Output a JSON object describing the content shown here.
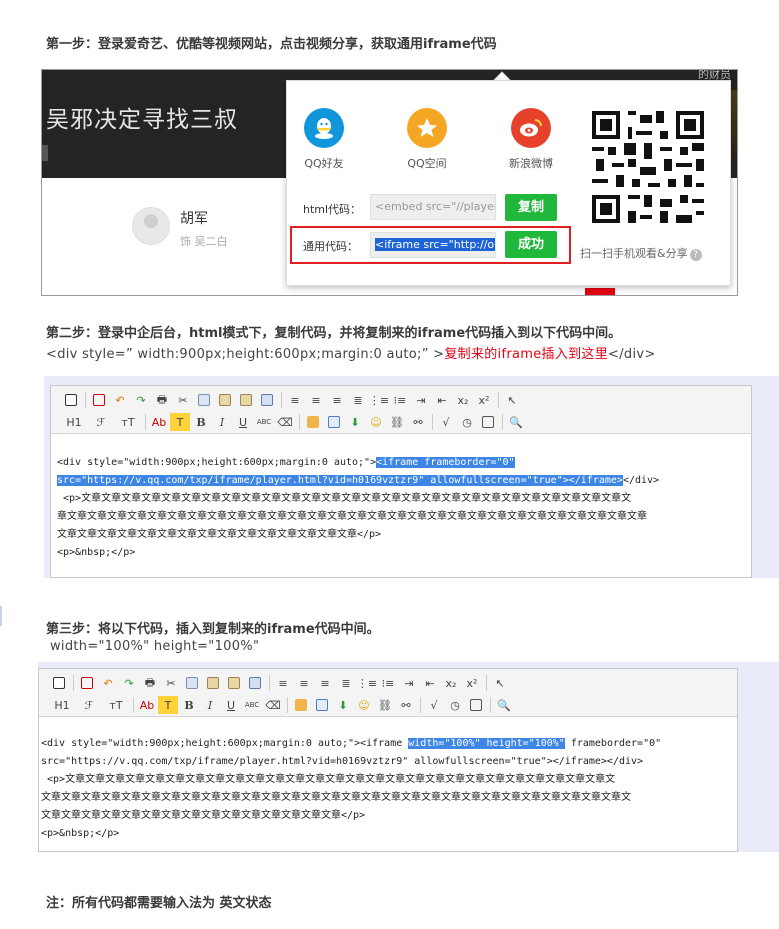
{
  "step1": {
    "title": "第一步：登录爱奇艺、优酷等视频网站，点击视频分享，获取通用iframe代码",
    "video_title": "吴邪决定寻找三叔",
    "cast_tag": "的财员",
    "actor_name": "胡军",
    "actor_role": "饰 吴二白",
    "share": {
      "targets": [
        {
          "label": "QQ好友",
          "icon": "qq-friend-icon",
          "color": "#1296db"
        },
        {
          "label": "QQ空间",
          "icon": "qzone-star-icon",
          "color": "#f5a623"
        },
        {
          "label": "新浪微博",
          "icon": "weibo-icon",
          "color": "#e6412a"
        }
      ],
      "html_code_label": "html代码：",
      "html_code_value": "<embed src=\"//player.",
      "generic_code_label": "通用代码：",
      "generic_code_value": "<iframe src=\"http://op",
      "copy_label": "复制",
      "success_label": "成功",
      "qr_caption": "扫一扫手机观看&分享",
      "help_glyph": "?"
    }
  },
  "step2": {
    "title": "第二步：登录中企后台，html模式下，复制代码，并将复制来的iframe代码插入到以下代码中间。",
    "code_prefix": "<div style=” width:900px;height:600px;margin:0 auto;” >",
    "code_insert": "复制来的iframe插入到这里",
    "code_suffix": "</div>",
    "editor": {
      "line1_a": "<div style=\"width:900px;height:600px;margin:0 auto;\">",
      "line1_b": "<iframe frameborder=\"0\"",
      "line2_a": "src=\"https://v.qq.com/txp/iframe/player.html?vid=h0169vztzr9\" allowfullscreen=\"true\"></iframe>",
      "line2_b": "</div>",
      "line3": " <p>文章文章文章文章文章文章文章文章文章文章文章文章文章文章文章文章文章文章文章文章文章文章文章文章文章文章文章文",
      "line4": "章文章文章文章文章文章文章文章文章文章文章文章文章文章文章文章文章文章文章文章文章文章文章文章文章文章文章文章文章文章",
      "line5": "文章文章文章文章文章文章文章文章文章文章文章文章文章文章文章</p>",
      "line6": "<p>&nbsp;</p>"
    }
  },
  "step3": {
    "title": "第三步：将以下代码，插入到复制来的iframe代码中间。",
    "code": "width=\"100%\" height=\"100%\"",
    "editor": {
      "line1_a": "<div style=\"width:900px;height:600px;margin:0 auto;\"><iframe ",
      "line1_b": "width=\"100%\" height=\"100%\"",
      "line1_c": " frameborder=\"0\"",
      "line2": "src=\"https://v.qq.com/txp/iframe/player.html?vid=h0169vztzr9\" allowfullscreen=\"true\"></iframe></div>",
      "line3": " <p>文章文章文章文章文章文章文章文章文章文章文章文章文章文章文章文章文章文章文章文章文章文章文章文章文章文章文章文",
      "line4": "文章文章文章文章文章文章文章文章文章文章文章文章文章文章文章文章文章文章文章文章文章文章文章文章文章文章文章文章文章文",
      "line5": "文章文章文章文章文章文章文章文章文章文章文章文章文章文章文章</p>",
      "line6": "<p>&nbsp;</p>"
    }
  },
  "toolbar": {
    "heading": "H1",
    "font": "ℱ",
    "size": "тT",
    "ab": "Ab",
    "t": "T",
    "bold": "B",
    "italic": "I",
    "underline": "U",
    "strike": "ABC",
    "sub": "x₂",
    "sup": "x²",
    "sqrt": "√"
  },
  "note": "注：所有代码都需要输入法为 英文状态"
}
